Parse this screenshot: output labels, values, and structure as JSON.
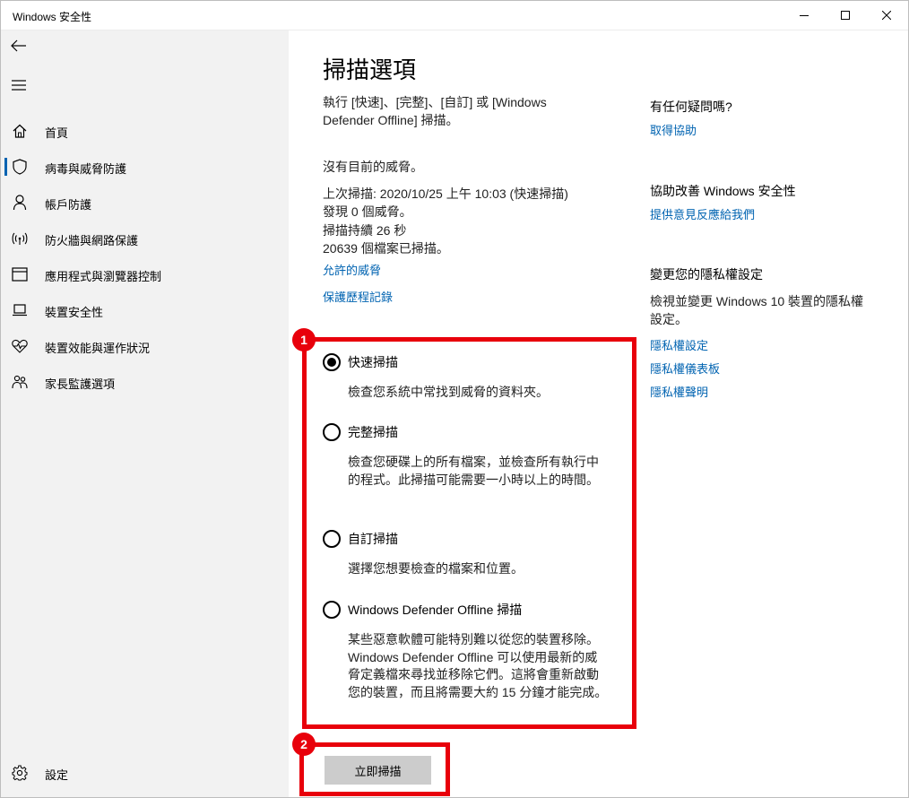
{
  "window": {
    "title": "Windows 安全性",
    "controls": {
      "minimize": "minimize-icon",
      "maximize": "maximize-icon",
      "close": "close-icon"
    }
  },
  "sidebar": {
    "back_icon": "back-arrow-icon",
    "menu_icon": "hamburger-icon",
    "items": [
      {
        "label": "首頁",
        "icon": "home-icon",
        "selected": false
      },
      {
        "label": "病毒與威脅防護",
        "icon": "shield-icon",
        "selected": true
      },
      {
        "label": "帳戶防護",
        "icon": "person-icon",
        "selected": false
      },
      {
        "label": "防火牆與網路保護",
        "icon": "wifi-icon",
        "selected": false
      },
      {
        "label": "應用程式與瀏覽器控制",
        "icon": "app-window-icon",
        "selected": false
      },
      {
        "label": "裝置安全性",
        "icon": "laptop-icon",
        "selected": false
      },
      {
        "label": "裝置效能與運作狀況",
        "icon": "heart-pulse-icon",
        "selected": false
      },
      {
        "label": "家長監護選項",
        "icon": "family-icon",
        "selected": false
      }
    ],
    "settings": {
      "label": "設定",
      "icon": "gear-icon"
    }
  },
  "main": {
    "title": "掃描選項",
    "intro": "執行 [快速]、[完整]、[自訂] 或 [Windows Defender Offline] 掃描。",
    "status_lines": [
      "沒有目前的威脅。",
      "上次掃描: 2020/10/25 上午 10:03 (快速掃描)",
      "發現 0 個威脅。",
      "掃描持續 26 秒",
      "20639 個檔案已掃描。"
    ],
    "links": {
      "allowed_threats": "允許的威脅",
      "protection_history": "保護歷程記錄"
    },
    "scan_options": [
      {
        "label": "快速掃描",
        "description": "檢查您系統中常找到威脅的資料夾。",
        "checked": true
      },
      {
        "label": "完整掃描",
        "description": "檢查您硬碟上的所有檔案，並檢查所有執行中的程式。此掃描可能需要一小時以上的時間。",
        "checked": false
      },
      {
        "label": "自訂掃描",
        "description": "選擇您想要檢查的檔案和位置。",
        "checked": false
      },
      {
        "label": "Windows Defender Offline 掃描",
        "description": "某些惡意軟體可能特別難以從您的裝置移除。Windows Defender Offline 可以使用最新的威脅定義檔來尋找並移除它們。這將會重新啟動您的裝置，而且將需要大約 15 分鐘才能完成。",
        "checked": false
      }
    ],
    "scan_button": "立即掃描"
  },
  "right_column": {
    "help": {
      "heading": "有任何疑問嗎?",
      "link": "取得協助"
    },
    "improve": {
      "heading": "協助改善 Windows 安全性",
      "link": "提供意見反應給我們"
    },
    "privacy": {
      "heading": "變更您的隱私權設定",
      "text": "檢視並變更 Windows 10 裝置的隱私權設定。",
      "links": [
        "隱私權設定",
        "隱私權儀表板",
        "隱私權聲明"
      ]
    }
  },
  "annotations": {
    "badge_1": "1",
    "badge_2": "2",
    "color": "#e8000b"
  },
  "colors": {
    "accent": "#0063b1",
    "sidebar_bg": "#f2f2f2",
    "button_bg": "#cccccc"
  }
}
